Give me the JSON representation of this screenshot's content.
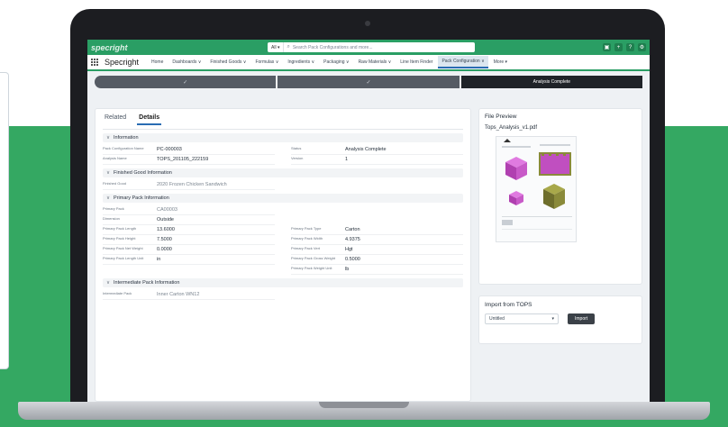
{
  "brand": {
    "logo_text": "specright"
  },
  "search": {
    "scope": "All",
    "placeholder": "Search Pack Configurations and more..."
  },
  "util_icons": [
    "quick-actions-icon",
    "add-icon",
    "help-icon",
    "settings-icon"
  ],
  "nav": {
    "app_name": "Specright",
    "items": [
      {
        "label": "Home",
        "active": false
      },
      {
        "label": "Dashboards ∨",
        "active": false
      },
      {
        "label": "Finished Goods ∨",
        "active": false
      },
      {
        "label": "Formulas ∨",
        "active": false
      },
      {
        "label": "Ingredients ∨",
        "active": false
      },
      {
        "label": "Packaging ∨",
        "active": false
      },
      {
        "label": "Raw Materials ∨",
        "active": false
      },
      {
        "label": "Line Item Finder",
        "active": false
      },
      {
        "label": "Pack Configuration ∨",
        "active": true
      },
      {
        "label": "More ▾",
        "active": false
      }
    ]
  },
  "path": {
    "steps": [
      "✓",
      "✓",
      "Analysis Complete"
    ]
  },
  "tabs": [
    "Related",
    "Details"
  ],
  "sections": {
    "information": {
      "title": "Information",
      "left": [
        {
          "label": "Pack Configuration Name",
          "value": "PC-000003"
        },
        {
          "label": "Analysis Name",
          "value": "TOPS_201105_222159"
        }
      ],
      "right": [
        {
          "label": "Status",
          "value": "Analysis Complete"
        },
        {
          "label": "Version",
          "value": "1"
        }
      ]
    },
    "finished_good": {
      "title": "Finished Good Information",
      "left": [
        {
          "label": "Finished Good",
          "value": "2020 Frozen Chicken Sandwich"
        }
      ]
    },
    "primary_pack": {
      "title": "Primary Pack Information",
      "left": [
        {
          "label": "Primary Pack",
          "value": "CA00003"
        },
        {
          "label": "Dimension",
          "value": "Outside"
        },
        {
          "label": "Primary Pack Length",
          "value": "13.6000"
        },
        {
          "label": "Primary Pack Height",
          "value": "7.5000"
        },
        {
          "label": "Primary Pack Net Weight",
          "value": "0.0000"
        },
        {
          "label": "Primary Pack Length Unit",
          "value": "in"
        }
      ],
      "right": [
        {
          "label": "",
          "value": ""
        },
        {
          "label": "",
          "value": ""
        },
        {
          "label": "Primary Pack Type",
          "value": "Carton"
        },
        {
          "label": "Primary Pack Width",
          "value": "4.9375"
        },
        {
          "label": "Primary Pack Vert",
          "value": "Hgt"
        },
        {
          "label": "Primary Pack Gross Weight",
          "value": "0.5000"
        },
        {
          "label": "Primary Pack Weight Unit",
          "value": "lb"
        }
      ]
    },
    "intermediate": {
      "title": "Intermediate Pack Information",
      "left": [
        {
          "label": "Intermediate Pack",
          "value": "Inner Carton WN12"
        }
      ]
    }
  },
  "file_preview": {
    "title": "File Preview",
    "file_name": "Tops_Analysis_v1.pdf"
  },
  "import": {
    "title": "Import from TOPS",
    "select_value": "Untitled",
    "button": "Import"
  },
  "colors": {
    "brand_green": "#34a862",
    "appbar_green": "#2a9e64",
    "box_magenta": "#c04fc0",
    "box_olive": "#8a8a3a"
  }
}
